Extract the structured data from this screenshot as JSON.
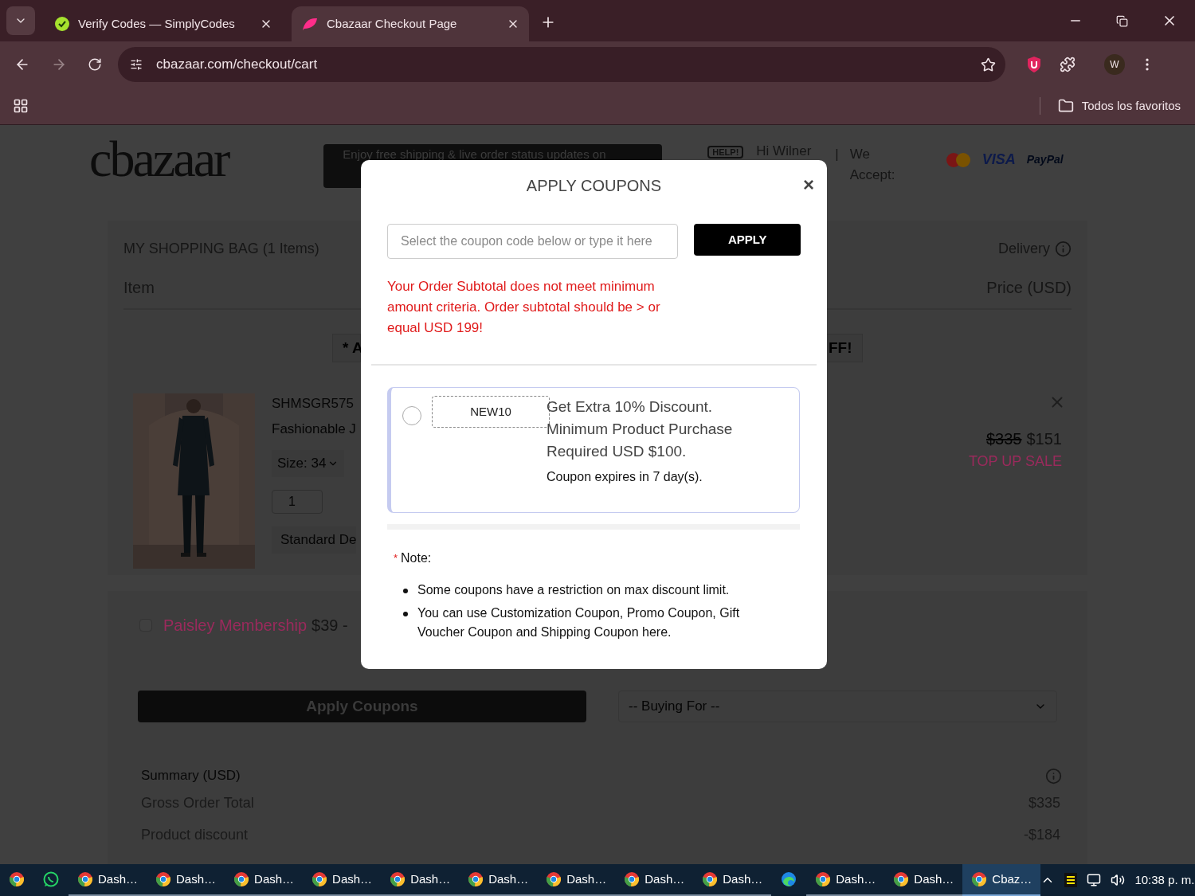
{
  "browser": {
    "tabs": [
      {
        "title": "Verify Codes — SimplyCodes",
        "kind": "simplycodes",
        "selected": false
      },
      {
        "title": "Cbazaar Checkout Page",
        "kind": "cbazaar",
        "selected": true
      }
    ],
    "url": "cbazaar.com/checkout/cart",
    "profile": "W",
    "bookmarks": "Todos los favoritos"
  },
  "page": {
    "logo": "cbazaar",
    "banner": "Enjoy free shipping & live order status updates on",
    "help": "HELP!",
    "greeting": "Hi Wilner",
    "separator": "|",
    "accept": "We Accept:",
    "payments": [
      {
        "label": "VISA",
        "kind": "visa"
      },
      {
        "label": "PayPal",
        "kind": "paypal"
      }
    ],
    "bag": {
      "title": "MY SHOPPING BAG (1 Items)",
      "delivery": "Delivery",
      "columns": [
        "Item",
        "Price (USD)"
      ],
      "promo_left": "* A",
      "promo_right": "FF!",
      "product": {
        "sku": "SHMSGR575",
        "name": "Fashionable J",
        "size": "Size: 34",
        "quantity": "1",
        "shipping": "Standard De",
        "old_price": "$335",
        "price": "$151",
        "sale": "TOP UP SALE"
      }
    },
    "membership": {
      "label": "Paisley Membership",
      "price": "$39 -",
      "checked": false
    },
    "apply_button": "Apply Coupons",
    "buying_for": "-- Buying For --",
    "summary": {
      "title": "Summary (USD)",
      "rows": [
        {
          "label": "Gross Order Total",
          "value": "$335"
        },
        {
          "label": "Product discount",
          "value": "-$184"
        }
      ]
    }
  },
  "modal": {
    "title": "APPLY COUPONS",
    "close": "×",
    "placeholder": "Select the coupon code below or type it here",
    "apply": "APPLY",
    "error": "Your Order Subtotal does not meet minimum amount criteria. Order subtotal should be > or equal USD 199!",
    "coupons": [
      {
        "code": "NEW10",
        "description": "Get Extra 10% Discount. Minimum Product Purchase Required USD $100.",
        "expiry": "Coupon expires in 7 day(s).",
        "selected": false
      }
    ],
    "note_marker": "*",
    "note_title": "Note:",
    "notes": [
      "Some coupons have a restriction on max discount limit.",
      "You can use Customization Coupon, Promo Coupon, Gift Voucher Coupon and Shipping Coupon here."
    ]
  },
  "taskbar": {
    "items": [
      {
        "kind": "chrome",
        "selected": false
      },
      {
        "kind": "whatsapp",
        "selected": false
      },
      {
        "kind": "chrome",
        "label": "Dash…",
        "selected": false
      },
      {
        "kind": "chrome",
        "label": "Dash…",
        "selected": false
      },
      {
        "kind": "chrome",
        "label": "Dash…",
        "selected": false
      },
      {
        "kind": "chrome",
        "label": "Dash…",
        "selected": false
      },
      {
        "kind": "chrome",
        "label": "Dash…",
        "selected": false
      },
      {
        "kind": "chrome",
        "label": "Dash…",
        "selected": false
      },
      {
        "kind": "chrome",
        "label": "Dash…",
        "selected": false
      },
      {
        "kind": "chrome",
        "label": "Dash…",
        "selected": false
      },
      {
        "kind": "chrome",
        "label": "Dash…",
        "selected": false
      },
      {
        "kind": "edge",
        "selected": false
      },
      {
        "kind": "chrome",
        "label": "Dash…",
        "selected": false
      },
      {
        "kind": "chrome",
        "label": "Dash…",
        "selected": false
      },
      {
        "kind": "chrome",
        "label": "Cbaz…",
        "selected": true
      }
    ],
    "time": "10:38 p. m."
  }
}
